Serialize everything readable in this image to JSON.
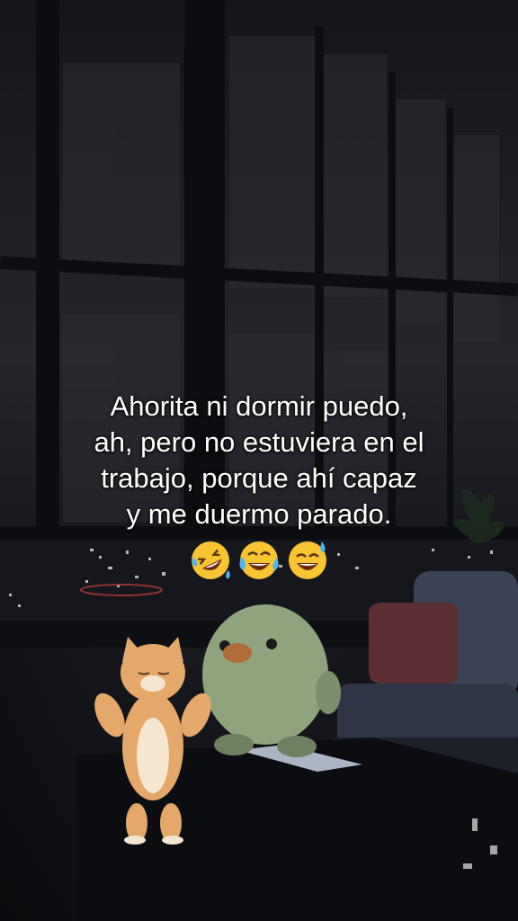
{
  "caption": {
    "lines": [
      "Ahorita ni dormir puedo,",
      "ah, pero no estuviera en el",
      "trabajo, porque ahí capaz",
      "y me duermo parado."
    ]
  },
  "emojis": [
    {
      "name": "rolling-on-floor-laughing-emoji",
      "glyph": "🤣"
    },
    {
      "name": "tears-of-joy-emoji",
      "glyph": "😂"
    },
    {
      "name": "grinning-sweat-emoji",
      "glyph": "😅"
    }
  ],
  "colors": {
    "caption_text": "#ffffff",
    "emoji_face": "#f7c531",
    "plush": "#8fa37e",
    "cat_fur": "#e3a86a",
    "sofa": "#3b4256",
    "pillow": "#5a2e33"
  }
}
